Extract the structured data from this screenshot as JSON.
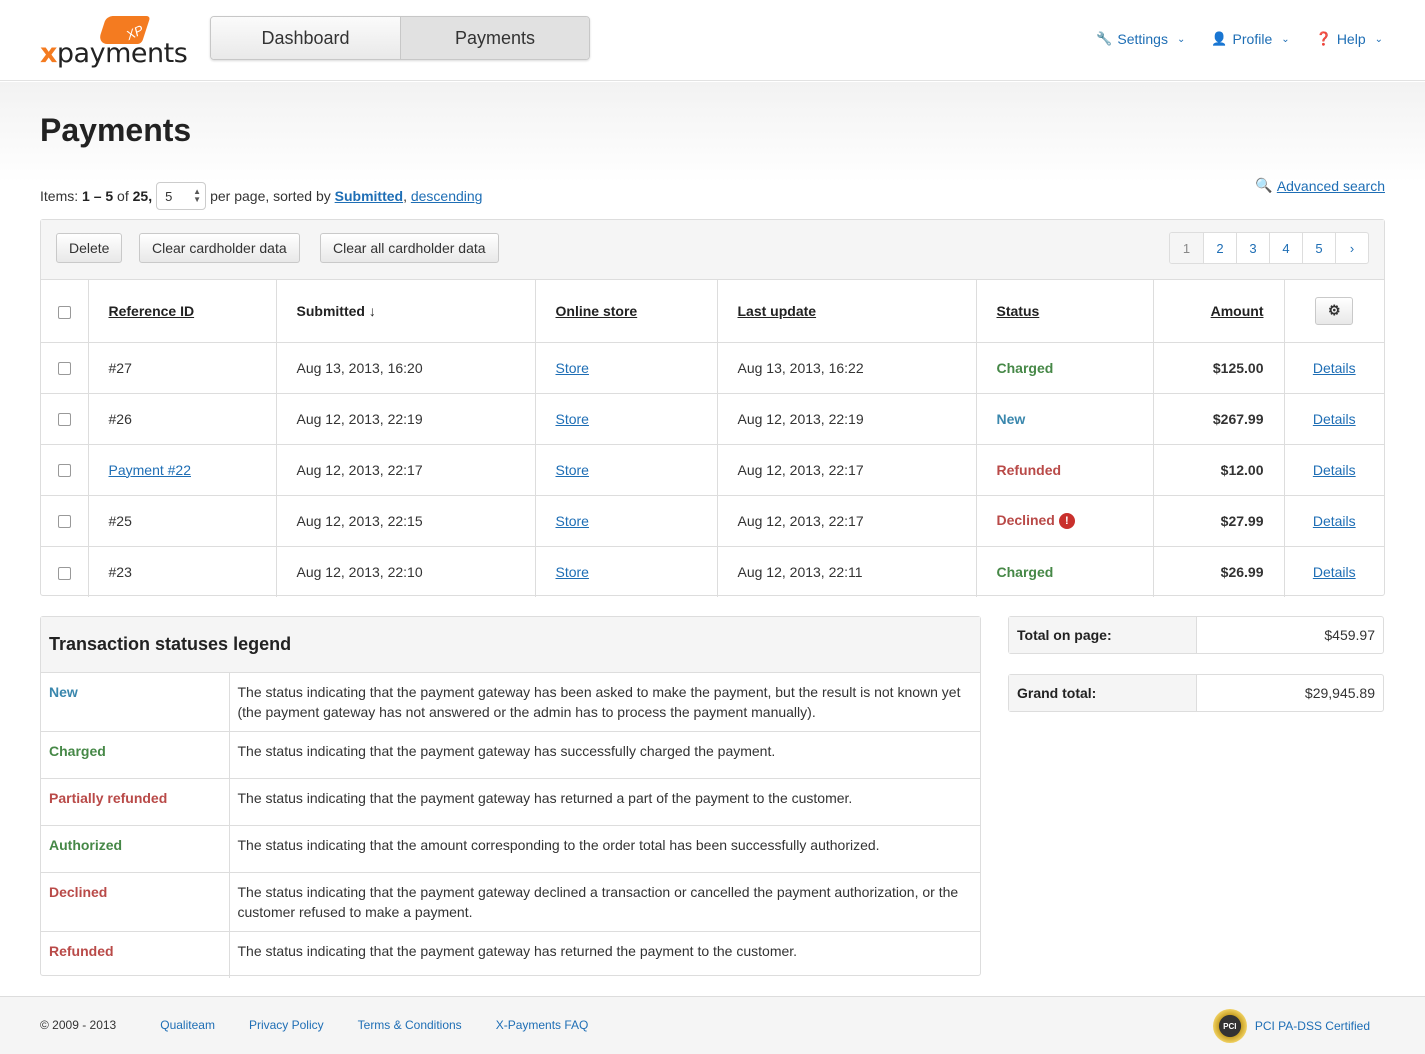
{
  "brand": {
    "logo_text": "payments",
    "logo_x": "x",
    "tag": "XP"
  },
  "tabs": [
    {
      "label": "Dashboard"
    },
    {
      "label": "Payments"
    }
  ],
  "topnav": [
    {
      "label": "Settings",
      "icon": "wrench-icon"
    },
    {
      "label": "Profile",
      "icon": "user-icon"
    },
    {
      "label": "Help",
      "icon": "question-icon"
    }
  ],
  "page": {
    "title": "Payments"
  },
  "items": {
    "prefix": "Items:",
    "range": "1 – 5",
    "of": "of",
    "total": "25,",
    "per_page_value": "5",
    "per_page_text": "per page, sorted by",
    "sort_field": "Submitted",
    "comma": ",",
    "sort_order": "descending"
  },
  "advanced_search": "Advanced search",
  "toolbar": {
    "delete": "Delete",
    "clear_cardholder": "Clear cardholder data",
    "clear_all_cardholder": "Clear all cardholder data"
  },
  "pager": [
    "1",
    "2",
    "3",
    "4",
    "5",
    "›"
  ],
  "columns": {
    "ref": "Reference ID",
    "submitted": "Submitted ↓",
    "store": "Online store",
    "last_update": "Last update",
    "status": "Status",
    "amount": "Amount"
  },
  "rows": [
    {
      "ref": "#27",
      "submitted": "Aug 13, 2013, 16:20",
      "store": "Store",
      "last_update": "Aug 13, 2013, 16:22",
      "status": "Charged",
      "amount": "$125.00",
      "details": "Details"
    },
    {
      "ref": "#26",
      "submitted": "Aug 12, 2013, 22:19",
      "store": "Store",
      "last_update": "Aug 12, 2013, 22:19",
      "status": "New",
      "amount": "$267.99",
      "details": "Details"
    },
    {
      "ref": "Payment #22",
      "submitted": "Aug 12, 2013, 22:17",
      "store": "Store",
      "last_update": "Aug 12, 2013, 22:17",
      "status": "Refunded",
      "amount": "$12.00",
      "details": "Details"
    },
    {
      "ref": "#25",
      "submitted": "Aug 12, 2013, 22:15",
      "store": "Store",
      "last_update": "Aug 12, 2013, 22:17",
      "status": "Declined",
      "amount": "$27.99",
      "details": "Details"
    },
    {
      "ref": "#23",
      "submitted": "Aug 12, 2013, 22:10",
      "store": "Store",
      "last_update": "Aug 12, 2013, 22:11",
      "status": "Charged",
      "amount": "$26.99",
      "details": "Details"
    }
  ],
  "legend": {
    "title": "Transaction statuses legend",
    "items": [
      {
        "name": "New",
        "desc": "The status indicating that the payment gateway has been asked to make the payment, but the result is not known yet (the payment gateway has not answered or the admin has to process the payment manually)."
      },
      {
        "name": "Charged",
        "desc": "The status indicating that the payment gateway has successfully charged the payment."
      },
      {
        "name": "Partially refunded",
        "desc": "The status indicating that the payment gateway has returned a part of the payment to the customer."
      },
      {
        "name": "Authorized",
        "desc": "The status indicating that the amount corresponding to the order total has been successfully authorized."
      },
      {
        "name": "Declined",
        "desc": "The status indicating that the payment gateway declined a transaction or cancelled the payment authorization, or the customer refused to make a payment."
      },
      {
        "name": "Refunded",
        "desc": "The status indicating that the payment gateway has returned the payment to the customer."
      }
    ]
  },
  "totals": {
    "page_label": "Total on page:",
    "page_value": "$459.97",
    "grand_label": "Grand total:",
    "grand_value": "$29,945.89"
  },
  "footer": {
    "copyright": "© 2009 - 2013",
    "company": "Qualiteam",
    "privacy": "Privacy Policy",
    "terms": "Terms & Conditions",
    "faq": "X-Payments FAQ",
    "pci": "PCI PA-DSS Certified",
    "pci_badge": "PCI"
  },
  "colors": {
    "accent": "#1e6eb5",
    "brand_orange": "#f47b20",
    "charged": "#468847",
    "new": "#3a87ad",
    "refunded": "#b94a48",
    "declined": "#b94a48"
  }
}
